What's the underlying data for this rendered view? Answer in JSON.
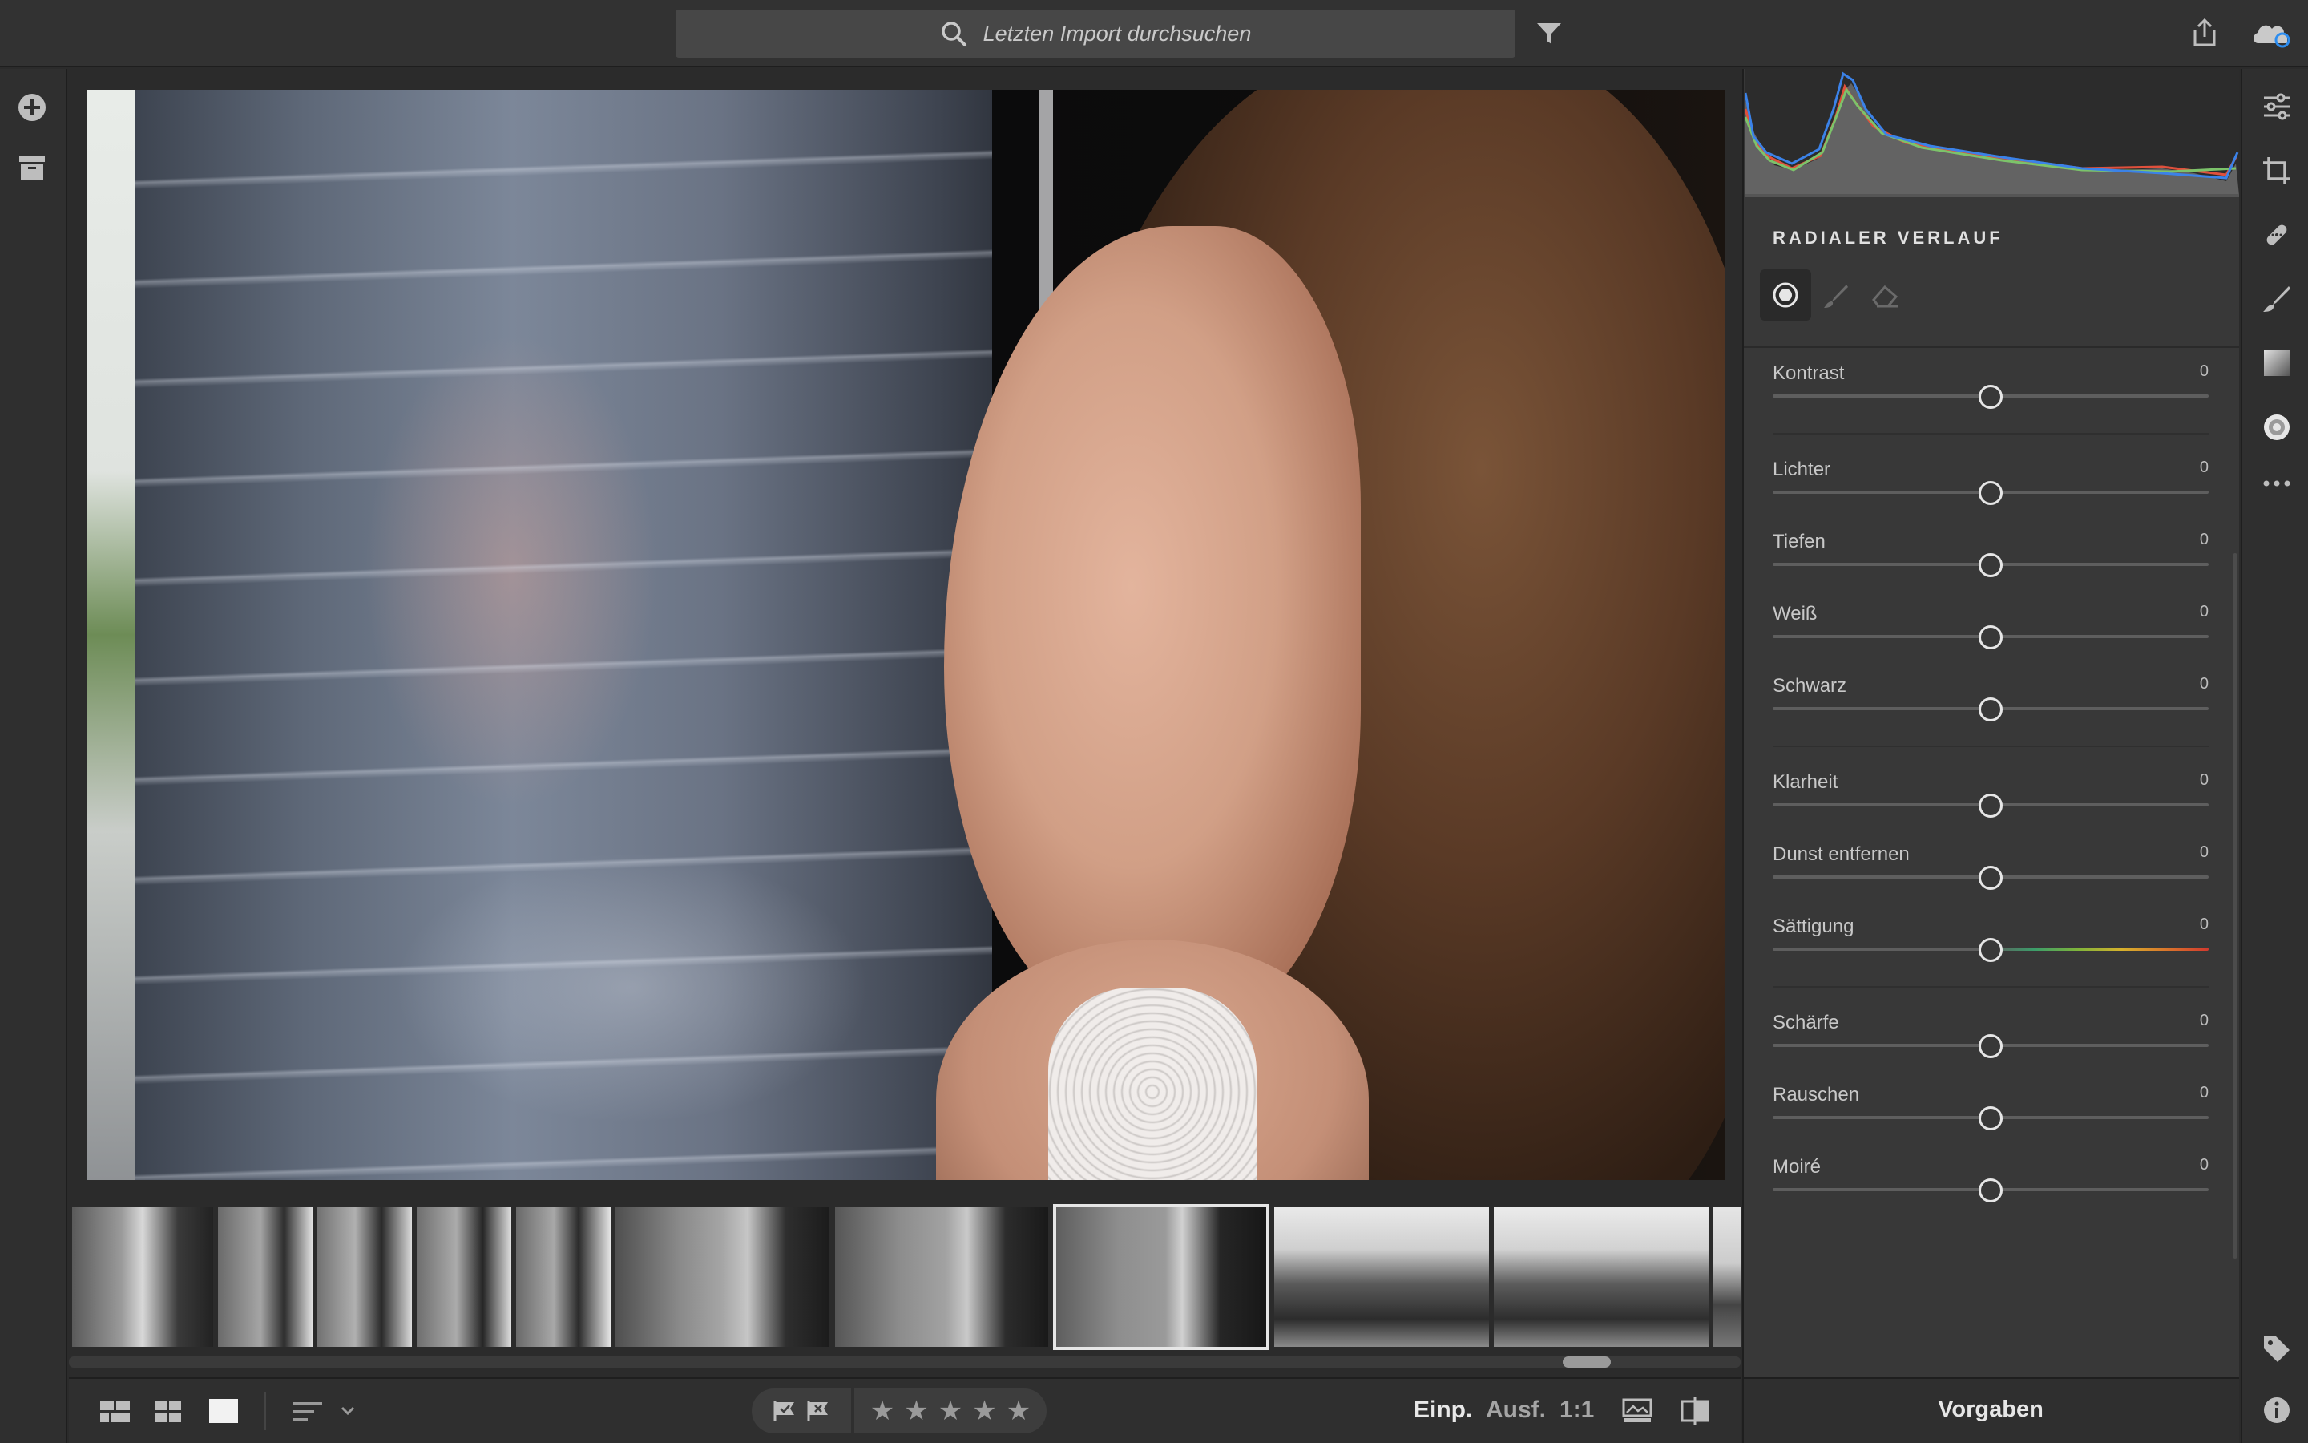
{
  "search": {
    "placeholder": "Letzten Import durchsuchen"
  },
  "panel": {
    "title": "RADIALER VERLAUF",
    "sliders": [
      {
        "label": "Kontrast",
        "value": "0",
        "position": 0.5
      },
      {
        "label": "Lichter",
        "value": "0",
        "position": 0.5
      },
      {
        "label": "Tiefen",
        "value": "0",
        "position": 0.5
      },
      {
        "label": "Weiß",
        "value": "0",
        "position": 0.5
      },
      {
        "label": "Schwarz",
        "value": "0",
        "position": 0.5
      },
      {
        "label": "Klarheit",
        "value": "0",
        "position": 0.5
      },
      {
        "label": "Dunst entfernen",
        "value": "0",
        "position": 0.5
      },
      {
        "label": "Sättigung",
        "value": "0",
        "position": 0.5
      },
      {
        "label": "Schärfe",
        "value": "0",
        "position": 0.5
      },
      {
        "label": "Rauschen",
        "value": "0",
        "position": 0.5
      },
      {
        "label": "Moiré",
        "value": "0",
        "position": 0.5
      }
    ]
  },
  "bottombar": {
    "einp": "Einp.",
    "ausf": "Ausf.",
    "zoom": "1:1",
    "stars": [
      "★",
      "★",
      "★",
      "★",
      "★"
    ]
  },
  "presets": {
    "label": "Vorgaben"
  },
  "colors": {
    "accent_cloud": "#2c8df0",
    "histogram_red": "#e0503c",
    "histogram_green": "#7cc36a",
    "histogram_blue": "#3b82e8"
  }
}
